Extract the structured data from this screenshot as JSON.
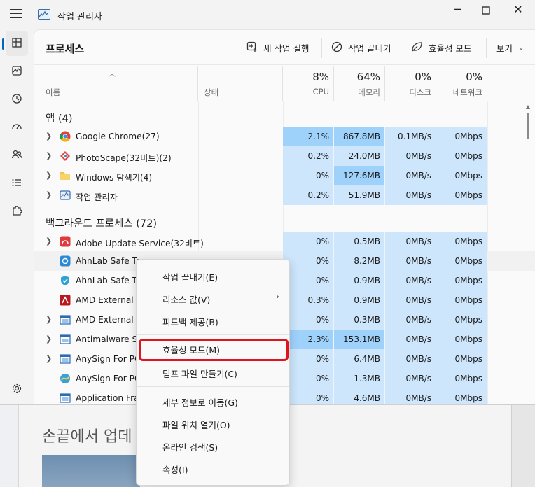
{
  "window": {
    "title": "작업 관리자"
  },
  "toolbar": {
    "page_title": "프로세스",
    "new_task_label": "새 작업 실행",
    "end_task_label": "작업 끝내기",
    "efficiency_label": "효율성 모드",
    "view_label": "보기"
  },
  "columns": {
    "name_label": "이름",
    "status_label": "상태",
    "cpu_pct": "8%",
    "cpu_label": "CPU",
    "mem_pct": "64%",
    "mem_label": "메모리",
    "disk_pct": "0%",
    "disk_label": "디스크",
    "net_pct": "0%",
    "net_label": "네트워크"
  },
  "groups": {
    "apps_title": "앱 (4)",
    "bg_title": "백그라운드 프로세스 (72)"
  },
  "apps": [
    {
      "name": "Google Chrome(27)",
      "cpu": "2.1%",
      "mem": "867.8MB",
      "disk": "0.1MB/s",
      "net": "0Mbps"
    },
    {
      "name": "PhotoScape(32비트)(2)",
      "cpu": "0.2%",
      "mem": "24.0MB",
      "disk": "0MB/s",
      "net": "0Mbps"
    },
    {
      "name": "Windows 탐색기(4)",
      "cpu": "0%",
      "mem": "127.6MB",
      "disk": "0MB/s",
      "net": "0Mbps"
    },
    {
      "name": "작업 관리자",
      "cpu": "0.2%",
      "mem": "51.9MB",
      "disk": "0MB/s",
      "net": "0Mbps"
    }
  ],
  "background": [
    {
      "name": "Adobe Update Service(32비트)",
      "cpu": "0%",
      "mem": "0.5MB",
      "disk": "0MB/s",
      "net": "0Mbps"
    },
    {
      "name": "AhnLab Safe Tra",
      "cpu": "0%",
      "mem": "8.2MB",
      "disk": "0MB/s",
      "net": "0Mbps"
    },
    {
      "name": "AhnLab Safe Tra",
      "cpu": "0%",
      "mem": "0.9MB",
      "disk": "0MB/s",
      "net": "0Mbps"
    },
    {
      "name": "AMD External Ev",
      "cpu": "0.3%",
      "mem": "0.9MB",
      "disk": "0MB/s",
      "net": "0Mbps"
    },
    {
      "name": "AMD External Ev",
      "cpu": "0%",
      "mem": "0.3MB",
      "disk": "0MB/s",
      "net": "0Mbps"
    },
    {
      "name": "Antimalware Ser",
      "cpu": "2.3%",
      "mem": "153.1MB",
      "disk": "0MB/s",
      "net": "0Mbps"
    },
    {
      "name": "AnySign For PC",
      "cpu": "0%",
      "mem": "6.4MB",
      "disk": "0MB/s",
      "net": "0Mbps"
    },
    {
      "name": "AnySign For PC",
      "cpu": "0%",
      "mem": "1.3MB",
      "disk": "0MB/s",
      "net": "0Mbps"
    },
    {
      "name": "Application Fran",
      "cpu": "0%",
      "mem": "4.6MB",
      "disk": "0MB/s",
      "net": "0Mbps"
    }
  ],
  "context_menu": {
    "end_task": "작업 끝내기(E)",
    "resource_values": "리소스 값(V)",
    "feedback": "피드백 제공(B)",
    "efficiency_mode": "효율성 모드(M)",
    "dump_file": "덤프 파일 만들기(C)",
    "go_details": "세부 정보로 이동(G)",
    "open_location": "파일 위치 열기(O)",
    "search_online": "온라인 검색(S)",
    "properties": "속성(I)"
  },
  "background_page": {
    "heading": "손끝에서 업데"
  },
  "colors": {
    "accent": "#0067c0",
    "highlight_box": "#e0141e",
    "heat_low": "#ddeeff",
    "heat_mid": "#cde6fc",
    "heat_high": "#9fd2fb"
  }
}
